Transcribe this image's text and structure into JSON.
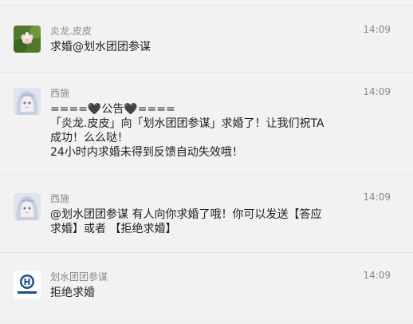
{
  "messages": [
    {
      "sender": "炎龙.皮皮",
      "time": "14:09",
      "avatar": "lotus-avatar-icon",
      "lines": [
        "求婚@划水团团参谋"
      ]
    },
    {
      "sender": "西施",
      "time": "14:09",
      "avatar": "anime-girl-avatar-icon",
      "lines": [
        "====🖤公告🖤====",
        "「炎龙.皮皮」向「划水团团参谋」求婚了！让我们祝TA",
        "成功！么么哒！",
        "24小时内求婚未得到反馈自动失效哦！"
      ]
    },
    {
      "sender": "西施",
      "time": "14:09",
      "avatar": "anime-girl-avatar-icon",
      "lines": [
        "@划水团团参谋 有人向你求婚了哦！你可以发送【答应",
        "求婚】或者 【拒绝求婚】"
      ]
    },
    {
      "sender": "划水团团参谋",
      "time": "14:09",
      "avatar": "team-logo-avatar-icon",
      "lines": [
        "拒绝求婚"
      ]
    }
  ]
}
